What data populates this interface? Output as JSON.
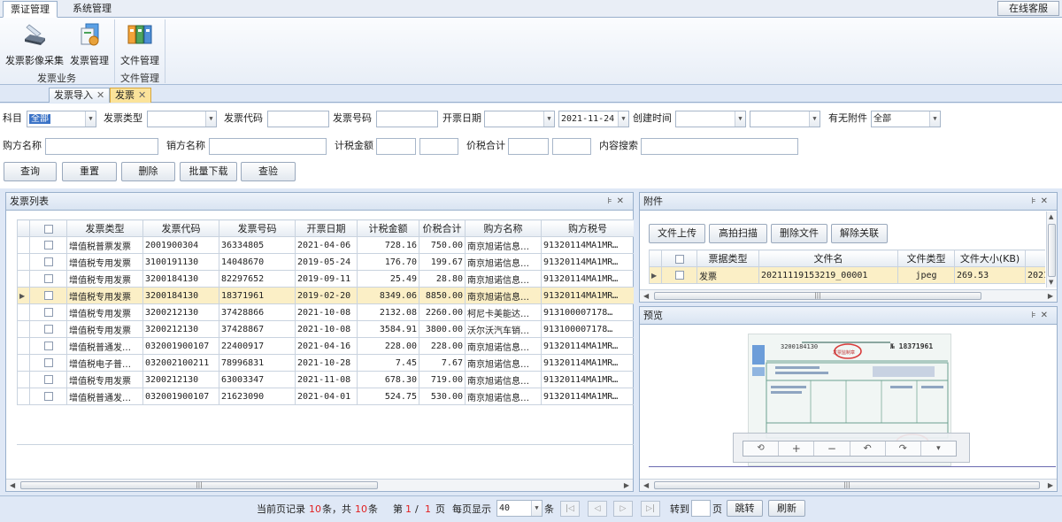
{
  "menu": {
    "tabs": [
      "票证管理",
      "系统管理"
    ],
    "online_service": "在线客服"
  },
  "ribbon": {
    "buttons": [
      "发票影像采集",
      "发票管理",
      "文件管理"
    ],
    "groups": [
      "发票业务",
      "文件管理"
    ]
  },
  "doc_tabs": [
    "发票导入",
    "发票"
  ],
  "filters": {
    "subject_label": "科目",
    "subject_value": "全部",
    "invoice_type_label": "发票类型",
    "invoice_code_label": "发票代码",
    "invoice_no_label": "发票号码",
    "issue_date_label": "开票日期",
    "issue_date_to": "2021-11-24",
    "create_time_label": "创建时间",
    "attachment_label": "有无附件",
    "attachment_value": "全部",
    "buyer_label": "购方名称",
    "seller_label": "销方名称",
    "tax_amount_label": "计税金额",
    "total_label": "价税合计",
    "content_label": "内容搜索"
  },
  "actions": [
    "查询",
    "重置",
    "删除",
    "批量下载",
    "查验"
  ],
  "invoice_list": {
    "title": "发票列表",
    "columns": [
      "发票类型",
      "发票代码",
      "发票号码",
      "开票日期",
      "计税金额",
      "价税合计",
      "购方名称",
      "购方税号"
    ],
    "rows": [
      [
        "增值税普票发票",
        "2001900304",
        "36334805",
        "2021-04-06",
        "728.16",
        "750.00",
        "南京旭诺信息…",
        "91320114MA1MR…"
      ],
      [
        "增值税专用发票",
        "3100191130",
        "14048670",
        "2019-05-24",
        "176.70",
        "199.67",
        "南京旭诺信息…",
        "91320114MA1MR…"
      ],
      [
        "增值税专用发票",
        "3200184130",
        "82297652",
        "2019-09-11",
        "25.49",
        "28.80",
        "南京旭诺信息…",
        "91320114MA1MR…"
      ],
      [
        "增值税专用发票",
        "3200184130",
        "18371961",
        "2019-02-20",
        "8349.06",
        "8850.00",
        "南京旭诺信息…",
        "91320114MA1MR…"
      ],
      [
        "增值税专用发票",
        "3200212130",
        "37428866",
        "2021-10-08",
        "2132.08",
        "2260.00",
        "柯尼卡美能达…",
        "913100007178…"
      ],
      [
        "增值税专用发票",
        "3200212130",
        "37428867",
        "2021-10-08",
        "3584.91",
        "3800.00",
        "沃尔沃汽车销…",
        "913100007178…"
      ],
      [
        "增值税普通发…",
        "032001900107",
        "22400917",
        "2021-04-16",
        "228.00",
        "228.00",
        "南京旭诺信息…",
        "91320114MA1MR…"
      ],
      [
        "增值税电子普…",
        "032002100211",
        "78996831",
        "2021-10-28",
        "7.45",
        "7.67",
        "南京旭诺信息…",
        "91320114MA1MR…"
      ],
      [
        "增值税专用发票",
        "3200212130",
        "63003347",
        "2021-11-08",
        "678.30",
        "719.00",
        "南京旭诺信息…",
        "91320114MA1MR…"
      ],
      [
        "增值税普通发…",
        "032001900107",
        "21623090",
        "2021-04-01",
        "524.75",
        "530.00",
        "南京旭诺信息…",
        "91320114MA1MR…"
      ]
    ],
    "selected_row": 3
  },
  "attachments": {
    "title": "附件",
    "buttons": [
      "文件上传",
      "高拍扫描",
      "删除文件",
      "解除关联"
    ],
    "columns": [
      "票据类型",
      "文件名",
      "文件类型",
      "文件大小(KB)"
    ],
    "rows": [
      [
        "发票",
        "20211119153219_00001",
        "jpeg",
        "269.53",
        "2021…"
      ]
    ]
  },
  "preview": {
    "title": "预览",
    "invoice_no_text": "№ 18371961",
    "invoice_code_text": "3200184130",
    "toolbar": [
      "⟲",
      "+",
      "−",
      "↶",
      "↷",
      "▾"
    ]
  },
  "pager": {
    "current_records_label": "当前页记录",
    "current_count": "10",
    "total_label": "条，共",
    "total_count": "10",
    "unit": "条",
    "page_label": "第",
    "page_current": "1",
    "page_sep": "/",
    "page_total": "1",
    "page_unit": "页",
    "per_page_label": "每页显示",
    "per_page": "40",
    "per_page_unit": "条",
    "goto_label": "转到",
    "goto_unit": "页",
    "jump": "跳转",
    "refresh": "刷新"
  }
}
